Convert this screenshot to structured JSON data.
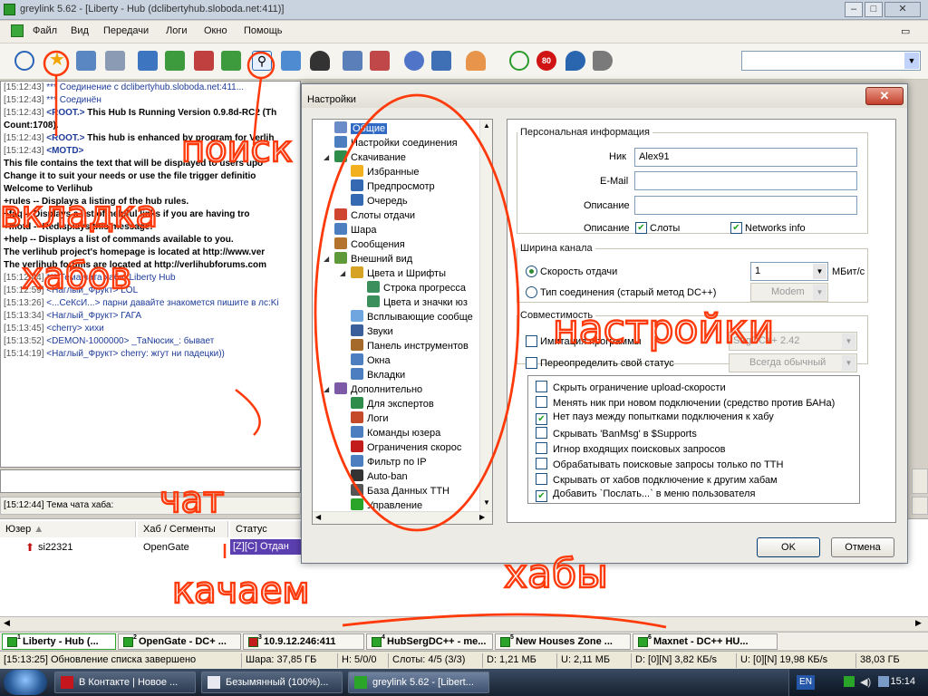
{
  "window": {
    "title": "greylink 5.62 - [Liberty - Hub (dclibertyhub.sloboda.net:411)]"
  },
  "menu": [
    "Файл",
    "Вид",
    "Передачи",
    "Логи",
    "Окно",
    "Помощь"
  ],
  "toolbar": {
    "icons": [
      "reconnect-icon",
      "favorites-star-icon",
      "users-icon",
      "follow-redirect-icon",
      "queue-icon",
      "finished-icon",
      "upload-queue-icon",
      "finished-uploads-icon",
      "search-icon",
      "adl-search-icon",
      "spy-icon",
      "file-list-icon",
      "notepad-icon",
      "settings-icon",
      "hash-icon",
      "user-dropdown-icon",
      "away-icon",
      "limit-80-icon",
      "flow-icon",
      "tts-icon"
    ],
    "search_value": ""
  },
  "chat": {
    "lines": [
      {
        "ts": "[15:12:43]",
        "text": "*** Соединение с dclibertyhub.sloboda.net:411...",
        "cls": "sys"
      },
      {
        "ts": "[15:12:43]",
        "text": "*** Соединён",
        "cls": "sys"
      },
      {
        "ts": "[15:12:43]",
        "nick": "<ROOT.>",
        "text": " This Hub Is Running Version 0.9.8d-RC2 (Th",
        "cls": "bold"
      },
      {
        "ts": "",
        "text": "Count:1708).",
        "cls": "bold"
      },
      {
        "ts": "[15:12:43]",
        "nick": "<ROOT.>",
        "text": " This hub is enhanced by program for Verlih",
        "cls": "bold"
      },
      {
        "ts": "[15:12:43]",
        "nick": "<MOTD>",
        "text": "",
        "cls": "bold"
      },
      {
        "ts": "",
        "text": "This file contains the text that will be displayed to users upo",
        "cls": "bold"
      },
      {
        "ts": "",
        "text": "Change it to suit your needs or use the file trigger definitio",
        "cls": "bold"
      },
      {
        "ts": "",
        "text": "",
        "cls": "bold"
      },
      {
        "ts": "",
        "text": "Welcome to Verlihub",
        "cls": "bold"
      },
      {
        "ts": "",
        "text": "",
        "cls": "bold"
      },
      {
        "ts": "",
        "text": "",
        "cls": "bold"
      },
      {
        "ts": "",
        "text": "+rules       -- Displays a listing of the hub rules.",
        "cls": "bold"
      },
      {
        "ts": "",
        "text": "+faq       -- Displays a list of helpful links if you are having tro",
        "cls": "bold"
      },
      {
        "ts": "",
        "text": "+motd       -- Redisplays this message.",
        "cls": "bold"
      },
      {
        "ts": "",
        "text": "+help       -- Displays a list of commands available to you.",
        "cls": "bold"
      },
      {
        "ts": "",
        "text": "",
        "cls": "bold"
      },
      {
        "ts": "",
        "text": "The verlihub project's homepage is located at http://www.ver",
        "cls": "bold"
      },
      {
        "ts": "",
        "text": "The verlihub forums are located at http://verlihubforums.com",
        "cls": "bold"
      },
      {
        "ts": "",
        "text": "",
        "cls": "bold"
      },
      {
        "ts": "[15:12:44]",
        "text": "*** Тема чата хаба:  Liberty Hub",
        "cls": "sys"
      },
      {
        "ts": "[15:12:59]",
        "nick": "<Наглый_Фрукт>",
        "text": " LOL",
        "cls": "nick"
      },
      {
        "ts": "[15:13:26]",
        "nick": "<...СеКсИ...>",
        "text": " парни давайте знакомется пишите в лс:Ki",
        "cls": "nick"
      },
      {
        "ts": "[15:13:34]",
        "nick": "<Наглый_Фрукт>",
        "text": " ГАГА",
        "cls": "nick"
      },
      {
        "ts": "[15:13:45]",
        "nick": "<cherry>",
        "text": " хихи",
        "cls": "nick"
      },
      {
        "ts": "[15:13:52]",
        "nick": "<DEMON-1000000>",
        "text": " _ТаNюсик_: бывает",
        "cls": "nick"
      },
      {
        "ts": "[15:14:19]",
        "nick": "<Наглый_Фрукт>",
        "text": " cherry: жгут ни падецки))",
        "cls": "nick"
      }
    ],
    "input_value": "",
    "topic": "[15:12:44] Тема чата хаба:"
  },
  "transfers": {
    "columns": [
      "Юзер",
      "Хаб / Сегменты",
      "Статус"
    ],
    "rows": [
      {
        "user": "si22321",
        "hub": "OpenGate",
        "status": "[Z][C] Отдан"
      }
    ]
  },
  "hub_tabs": [
    {
      "n": "1",
      "label": "Liberty - Hub (...",
      "color": "#2aa52a",
      "active": true
    },
    {
      "n": "2",
      "label": "OpenGate - DC+ ...",
      "color": "#2aa52a"
    },
    {
      "n": "3",
      "label": "10.9.12.246:411",
      "color": "#c21c1c"
    },
    {
      "n": "4",
      "label": "HubSergDC++ - me...",
      "color": "#2aa52a"
    },
    {
      "n": "5",
      "label": "New Houses Zone ...",
      "color": "#2aa52a"
    },
    {
      "n": "6",
      "label": "Maxnet - DC++ HU...",
      "color": "#2aa52a"
    }
  ],
  "status": {
    "message": "[15:13:25] Обновление списка завершено",
    "share": "Шара: 37,85 ГБ",
    "hubs": "H: 5/0/0",
    "slots": "Слоты: 4/5 (3/3)",
    "down": "D: 1,21 МБ",
    "up": "U: 2,11 МБ",
    "down_rate": "D: [0][N] 3,82 КБ/s",
    "up_rate": "U: [0][N] 19,98 КБ/s",
    "free": "38,03 ГБ"
  },
  "taskbar": {
    "tasks": [
      {
        "label": "В Контакте | Новое ...",
        "icon": "opera-icon",
        "color": "#c4161c"
      },
      {
        "label": "Безымянный (100%)...",
        "icon": "paint-icon",
        "color": "#e8e8f0"
      },
      {
        "label": "greylink 5.62 - [Libert...",
        "icon": "greylink-icon",
        "color": "#2aa52a",
        "active": true
      }
    ],
    "lang": "EN",
    "clock": "15:14"
  },
  "settings": {
    "title": "Настройки",
    "close_label": "✕",
    "tree": [
      {
        "label": "Общие",
        "lvl": 0,
        "sel": true,
        "color": "#6b8cc8"
      },
      {
        "label": "Настройки соединения",
        "lvl": 0,
        "color": "#4d7fc0"
      },
      {
        "label": "Скачивание",
        "lvl": 0,
        "exp": true,
        "color": "#2e8d4a"
      },
      {
        "label": "Избранные",
        "lvl": 1,
        "color": "#f2b01e"
      },
      {
        "label": "Предпросмотр",
        "lvl": 1,
        "color": "#3569b2"
      },
      {
        "label": "Очередь",
        "lvl": 1,
        "color": "#3569b2"
      },
      {
        "label": "Слоты отдачи",
        "lvl": 0,
        "color": "#d0452f"
      },
      {
        "label": "Шара",
        "lvl": 0,
        "color": "#4d7fc0"
      },
      {
        "label": "Сообщения",
        "lvl": 0,
        "color": "#b5742d"
      },
      {
        "label": "Внешний вид",
        "lvl": 0,
        "exp": true,
        "color": "#5f9a3a"
      },
      {
        "label": "Цвета и Шрифты",
        "lvl": 1,
        "exp": true,
        "color": "#d6a324"
      },
      {
        "label": "Строка прогресса",
        "lvl": 2,
        "color": "#3b8f5c"
      },
      {
        "label": "Цвета и значки юз",
        "lvl": 2,
        "color": "#3b8f5c"
      },
      {
        "label": "Всплывающие сообще",
        "lvl": 1,
        "color": "#6fa6e0"
      },
      {
        "label": "Звуки",
        "lvl": 1,
        "color": "#3a5f9a"
      },
      {
        "label": "Панель инструментов",
        "lvl": 1,
        "color": "#a56a2a"
      },
      {
        "label": "Окна",
        "lvl": 1,
        "color": "#4d7fc0"
      },
      {
        "label": "Вкладки",
        "lvl": 1,
        "color": "#4d7fc0"
      },
      {
        "label": "Дополнительно",
        "lvl": 0,
        "exp": true,
        "color": "#7c5aa6"
      },
      {
        "label": "Для экспертов",
        "lvl": 1,
        "color": "#2e8d4a"
      },
      {
        "label": "Логи",
        "lvl": 1,
        "color": "#c44a2a"
      },
      {
        "label": "Команды юзера",
        "lvl": 1,
        "color": "#4d7fc0"
      },
      {
        "label": "Ограничения скорос",
        "lvl": 1,
        "color": "#c21c1c"
      },
      {
        "label": "Фильтр по IP",
        "lvl": 1,
        "color": "#4d7fc0"
      },
      {
        "label": "Auto-ban",
        "lvl": 1,
        "color": "#333"
      },
      {
        "label": "База Данных TTH",
        "lvl": 1,
        "color": "#555"
      },
      {
        "label": "Управление",
        "lvl": 1,
        "color": "#2aa52a"
      }
    ],
    "personal": {
      "legend": "Персональная информация",
      "nick_label": "Ник",
      "nick_value": "Alex91",
      "email_label": "E-Mail",
      "email_value": "",
      "desc_label": "Описание",
      "desc_value": "",
      "desc2_label": "Описание",
      "slots_label": "Слоты",
      "networks_label": "Networks info"
    },
    "bandwidth": {
      "legend": "Ширина канала",
      "upload_speed_label": "Скорость отдачи",
      "upload_speed_value": "1",
      "unit": "МБит/с",
      "conn_type_label": "Тип соединения (старый метод DC++)",
      "conn_type_value": "Modem"
    },
    "compat": {
      "legend": "Совместимость",
      "emulate_label": "Имитация программы",
      "emulate_value": "StrgDC++ 2.42",
      "override_label": "Переопределить свой статус",
      "override_value": "Всегда обычный"
    },
    "options": [
      {
        "label": "Скрыть ограничение upload-скорости",
        "checked": false
      },
      {
        "label": "Менять ник при новом подключении (средство против БАНа)",
        "checked": false
      },
      {
        "label": "Нет пауз между попытками подключения к хабу",
        "checked": true
      },
      {
        "label": "Скрывать 'BanMsg' в $Supports",
        "checked": false
      },
      {
        "label": "Игнор входящих поисковых запросов",
        "checked": false
      },
      {
        "label": "Обрабатывать поисковые запросы только по TTH",
        "checked": false
      },
      {
        "label": "Скрывать от хабов подключение к другим хабам",
        "checked": false
      },
      {
        "label": "Добавить `Послать...` в меню пользователя",
        "checked": true
      }
    ],
    "ok_label": "OK",
    "cancel_label": "Отмена"
  },
  "annotations": [
    "поиск",
    "вкладка",
    "хабов",
    "настройки",
    "чат",
    "качаем",
    "хабы"
  ]
}
